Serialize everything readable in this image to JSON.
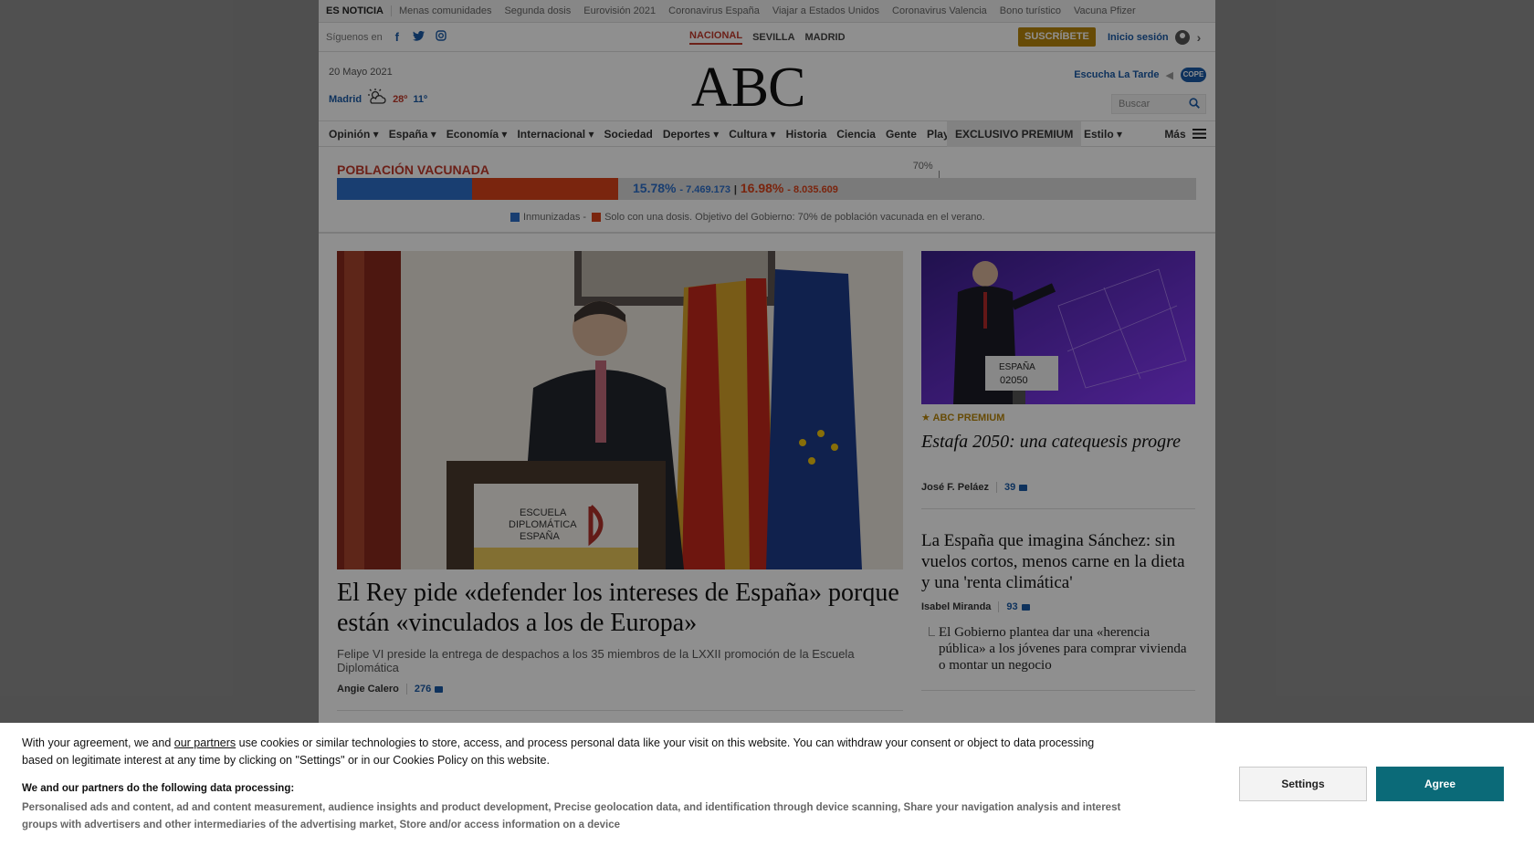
{
  "topbar": {
    "label": "ES NOTICIA",
    "links": [
      "Menas comunidades",
      "Segunda dosis",
      "Eurovisión 2021",
      "Coronavirus España",
      "Viajar a Estados Unidos",
      "Coronavirus Valencia",
      "Bono turístico",
      "Vacuna Pfizer"
    ]
  },
  "social": {
    "label": "Síguenos en",
    "icons": [
      "facebook-icon",
      "twitter-icon",
      "instagram-icon"
    ],
    "editions": [
      "NACIONAL",
      "SEVILLA",
      "MADRID"
    ],
    "active_edition": "NACIONAL",
    "subscribe": "SUSCRÍBETE",
    "login": "Inicio sesión"
  },
  "masthead": {
    "date": "20 Mayo 2021",
    "city": "Madrid",
    "temp_max": "28º",
    "temp_min": "11º",
    "logo": "ABC",
    "listen": "Escucha La Tarde",
    "cope": "COPE",
    "search_placeholder": "Buscar"
  },
  "nav": {
    "items": [
      "Opinión ▾",
      "España ▾",
      "Economía ▾",
      "Internacional ▾",
      "Sociedad",
      "Deportes ▾",
      "Cultura ▾",
      "Historia",
      "Ciencia",
      "Gente",
      "Play ▾"
    ],
    "premium": "EXCLUSIVO PREMIUM",
    "estilo": "Estilo ▾",
    "mas": "Más"
  },
  "vaccination": {
    "title": "POBLACIÓN VACUNADA",
    "goal_label": "70%",
    "goal_value": 70,
    "immunized_pct": 15.78,
    "immunized_pct_text": "15.78%",
    "immunized_count": "- 7.469.173",
    "separator": "|",
    "one_dose_pct": 16.98,
    "one_dose_pct_text": "16.98%",
    "one_dose_count": "- 8.035.609",
    "legend_immunized": "Inmunizadas -",
    "legend_one_dose": "Solo con una dosis. Objetivo del Gobierno: 70% de población vacunada en el verano.",
    "colors": {
      "immunized": "#2e6fc9",
      "one_dose": "#d9421a"
    }
  },
  "main_story": {
    "title": "El Rey pide «defender los intereses de España» porque están «vinculados a los de Europa»",
    "subtitle": "Felipe VI preside la entrega de despachos a los 35 miembros de la LXXII promoción de la Escuela Diplomática",
    "author": "Angie Calero",
    "comments": "276",
    "podium_text": [
      "ESCUELA",
      "DIPLOMÁTICA",
      "ESPAÑA"
    ]
  },
  "side_story_1": {
    "tag": "ABC PREMIUM",
    "title": "Estafa 2050: una catequesis progre",
    "author": "José F. Peláez",
    "comments": "39",
    "sign_text": [
      "ESPAÑA",
      "02050"
    ]
  },
  "side_story_2": {
    "title": "La España que imagina Sánchez: sin vuelos cortos, menos carne en la dieta y una 'renta climática'",
    "author": "Isabel Miranda",
    "comments": "93",
    "related": "El Gobierno plantea dar una «herencia pública» a los jóvenes para comprar vivienda o montar un negocio"
  },
  "cookie": {
    "text_before": "With your agreement, we and ",
    "link": "our partners",
    "text_after": " use cookies or similar technologies to store, access, and process personal data like your visit on this website. You can withdraw your consent or object to data processing based on legitimate interest at any time by clicking on \"Settings\" or in our Cookies Policy on this website.",
    "heading": "We and our partners do the following data processing:",
    "purposes": "Personalised ads and content, ad and content measurement, audience insights and product development, Precise geolocation data, and identification through device scanning, Share your navigation analysis and interest groups with advertisers and other intermediaries of the advertising market, Store and/or access information on a device",
    "settings": "Settings",
    "agree": "Agree"
  }
}
